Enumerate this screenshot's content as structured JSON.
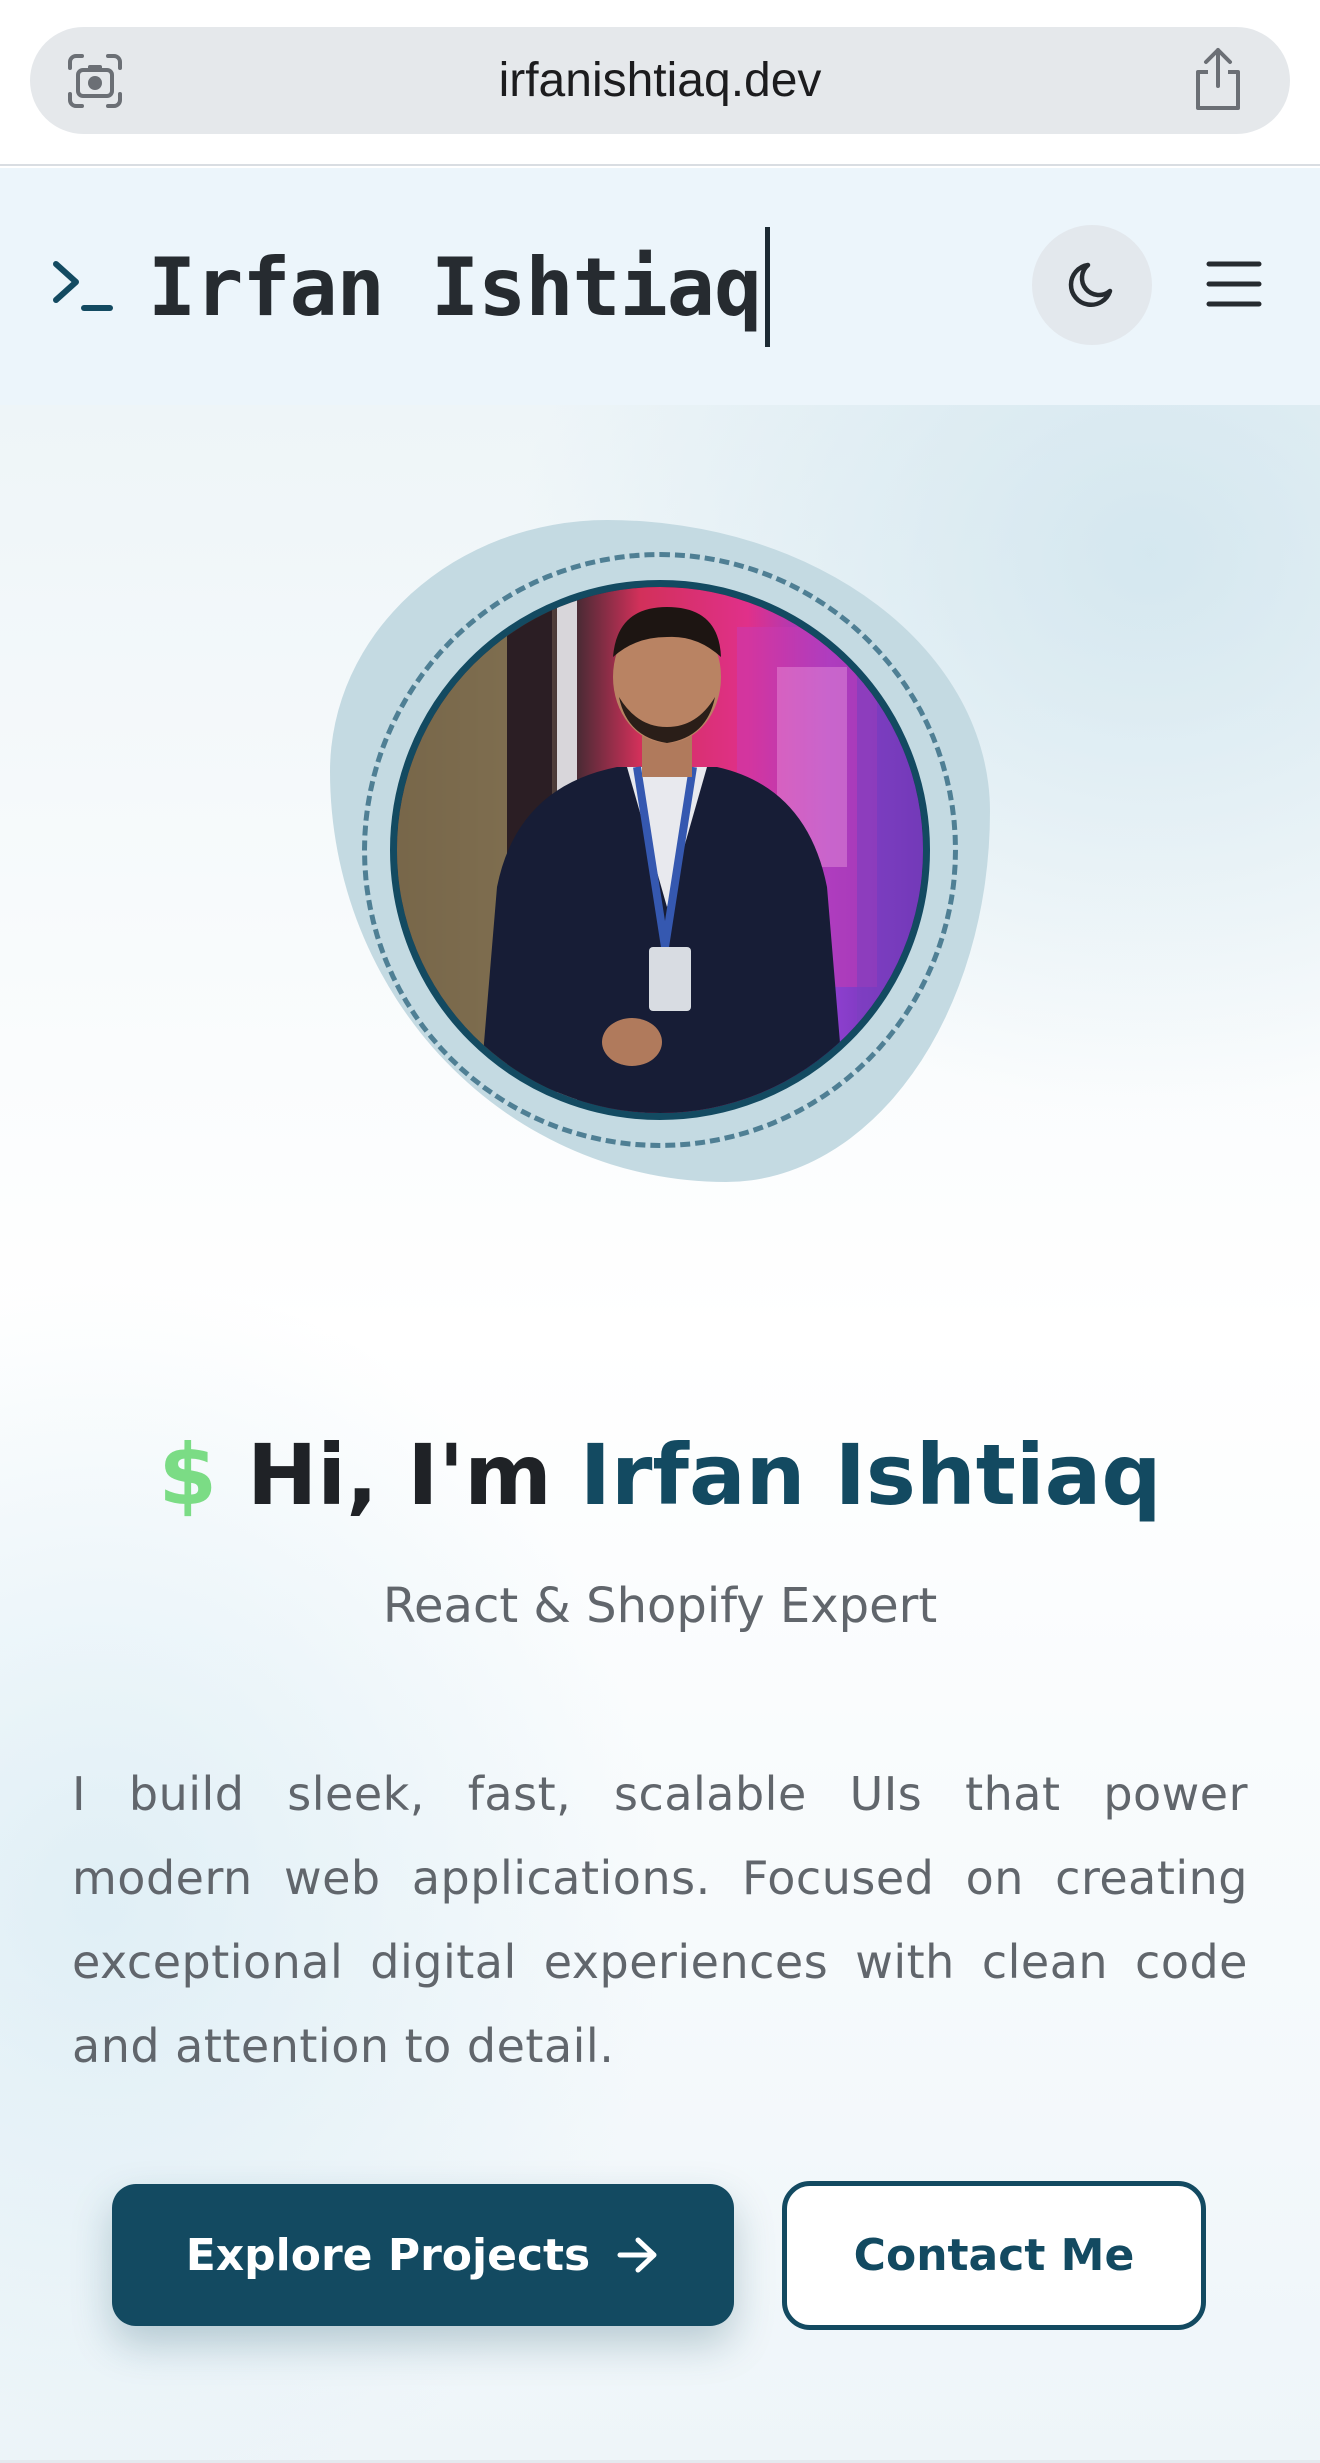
{
  "browser": {
    "url": "irfanishtiaq.dev",
    "lens_icon": "camera-lens-icon",
    "share_icon": "share-icon"
  },
  "header": {
    "logo_icon": "terminal-prompt-icon",
    "logo_text": "Irfan Ishtiaq",
    "theme_toggle_icon": "moon-icon",
    "menu_icon": "hamburger-menu-icon"
  },
  "hero": {
    "dollar": "$",
    "greeting": "Hi, I'm",
    "name": "Irfan Ishtiaq",
    "subtitle": "React & Shopify Expert",
    "bio": "I build sleek, fast, scalable UIs that power modern web applications. Focused on creating exceptional digital experiences with clean code and attention to detail.",
    "primary_button": "Explore Projects",
    "secondary_button": "Contact Me"
  },
  "colors": {
    "brand": "#134a61",
    "accent_green": "#7bdc85",
    "header_bg": "#ecf5fb",
    "text_dark": "#1f2226",
    "text_muted": "#61666c"
  }
}
